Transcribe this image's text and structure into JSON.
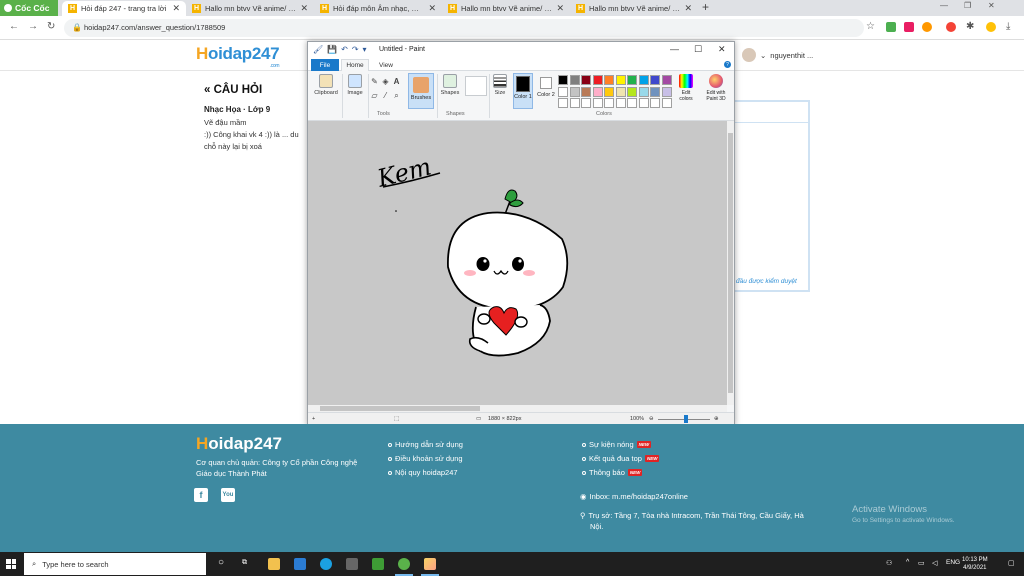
{
  "browser": {
    "brand": "Cốc Cốc",
    "tabs": [
      {
        "label": "Hỏi đáp 247 - trang tra lời",
        "active": true
      },
      {
        "label": "Hallo mn btvv Vẽ anime/ chi...",
        "active": false
      },
      {
        "label": "Hỏi đáp môn Âm nhạc, Mỹ th...",
        "active": false
      },
      {
        "label": "Hallo mn btvv Vẽ anime/ chi...",
        "active": false
      },
      {
        "label": "Hallo mn btvv Vẽ anime/ chi...",
        "active": false
      }
    ],
    "url": "hoidap247.com/answer_question/1788509"
  },
  "site": {
    "logo_h": "H",
    "logo_rest": "oidap247",
    "logo_com": ".com",
    "username": "nguyenthit ...",
    "question_heading": "« CÂU HỎI",
    "question_subject": "Nhạc Họa · Lớp 9",
    "question_line1": "Vẽ đậu mầm",
    "question_line2": ":)) Công khai vk 4 :)) là ... du",
    "question_line3": "chỗ này lại bị xoá",
    "panel_note": "đầu được kiểm duyệt"
  },
  "paint": {
    "title": "Untitled - Paint",
    "tabs": {
      "file": "File",
      "home": "Home",
      "view": "View"
    },
    "groups": {
      "clipboard": "Clipboard",
      "image": "Image",
      "tools": "Tools",
      "brushes": "Brushes",
      "shapes": "Shapes",
      "size": "Size",
      "colors": "Colors"
    },
    "color1": "Color 1",
    "color2": "Color 2",
    "edit_colors": "Edit colors",
    "edit_paint3d": "Edit with Paint 3D",
    "canvas_size": "1880 × 822px",
    "zoom": "100%",
    "drawing_text": "Kem",
    "palette": [
      "#000000",
      "#7f7f7f",
      "#880015",
      "#ed1c24",
      "#ff7f27",
      "#fff200",
      "#22b14c",
      "#00a2e8",
      "#3f48cc",
      "#a349a4",
      "#ffffff",
      "#c3c3c3",
      "#b97a57",
      "#ffaec9",
      "#ffc90e",
      "#efe4b0",
      "#b5e61d",
      "#99d9ea",
      "#7092be",
      "#c8bfe7",
      "#ffffff",
      "#ffffff",
      "#ffffff",
      "#ffffff",
      "#ffffff",
      "#ffffff",
      "#ffffff",
      "#ffffff",
      "#ffffff",
      "#ffffff"
    ]
  },
  "footer": {
    "logo_h": "H",
    "logo_rest": "oidap247",
    "owner_line1": "Cơ quan chủ quản: Công ty Cổ phần Công nghệ",
    "owner_line2": "Giáo dục Thành Phát",
    "links_col1": [
      "Hướng dẫn sử dụng",
      "Điều khoản sử dụng",
      "Nội quy hoidap247"
    ],
    "links_col2": [
      "Sự kiện nóng",
      "Kết quả đua top",
      "Thông báo"
    ],
    "new_badge": "NEW",
    "inbox": "Inbox: m.me/hoidap247online",
    "address_line1": "Trụ sở: Tầng 7, Tòa nhà Intracom, Trần Thái Tông, Cầu Giấy, Hà",
    "address_line2": "Nội.",
    "activate_title": "Activate Windows",
    "activate_sub": "Go to Settings to activate Windows."
  },
  "taskbar": {
    "search_placeholder": "Type here to search",
    "lang": "ENG",
    "time": "10:13 PM",
    "date": "4/9/2021"
  }
}
